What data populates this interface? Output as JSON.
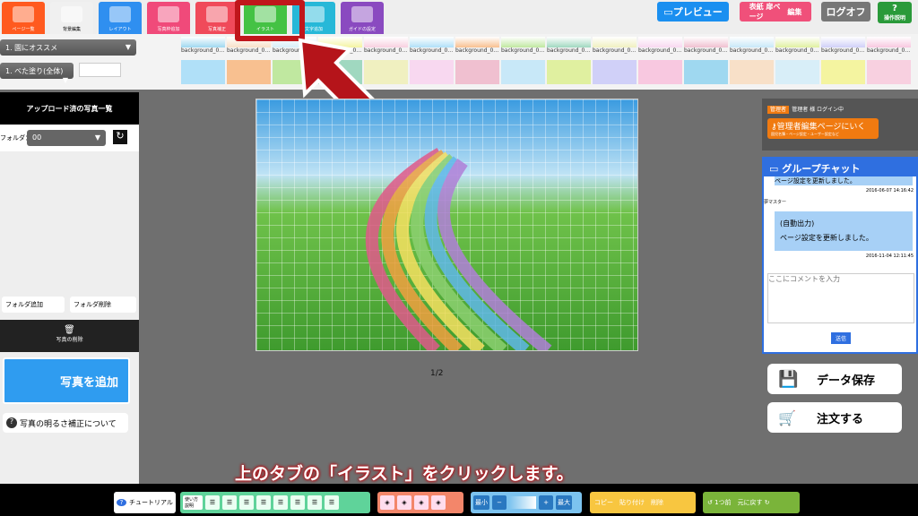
{
  "tabs": [
    {
      "label": "ページ一覧",
      "color": "#ff5a1f"
    },
    {
      "label": "背景編集",
      "color": "#f0f0f0"
    },
    {
      "label": "レイアウト",
      "color": "#2f8ff0"
    },
    {
      "label": "写真枠追加",
      "color": "#f04a7a"
    },
    {
      "label": "写真補正",
      "color": "#f04a5a"
    },
    {
      "label": "イラスト",
      "color": "#44c244"
    },
    {
      "label": "文字追加",
      "color": "#27b8d8"
    },
    {
      "label": "ガイドの設定",
      "color": "#8a4ac0"
    }
  ],
  "top_buttons": {
    "preview": "プレビュー",
    "cover": "表紙 扉ページ",
    "edit": "編集",
    "logoff": "ログオフ",
    "help": "操作説明"
  },
  "dropdowns": {
    "recommend": "1. 園にオススメ",
    "fill": "1. べた塗り(全体)"
  },
  "thumbnail_label": "background_0…",
  "left": {
    "title": "アップロード済の写真一覧",
    "folder_label": "フォルダ：",
    "folder_value": "00",
    "add_folder": "フォルダ追加",
    "delete_folder": "フォルダ削除",
    "delete_photo": "写真の削除",
    "add_photo": "写真を追加",
    "brightness": "写真の明るさ補正について"
  },
  "page_indicator": "1/2",
  "right": {
    "admin_badge": "管理者",
    "admin_login": "管理者 様 ログイン中",
    "admin_link": "管理者編集ページにいく",
    "admin_link_sub": "園児名簿・ページ設定・ユーザー設定など",
    "chat_title": "グループチャット",
    "msg1_tail": "ページ設定を更新しました。",
    "msg1_time": "2016-06-07 14:16:42",
    "sender": "夢マスター",
    "msg2_l1": "(自動出力)",
    "msg2_l2": "ページ設定を更新しました。",
    "msg2_time": "2016-11-04 12:11:45",
    "comment_placeholder": "ここにコメントを入力",
    "send": "送信",
    "save": "データ保存",
    "order": "注文する"
  },
  "caption": "上のタブの「イラスト」をクリックします。",
  "bottom": {
    "tutorial": "チュートリアル",
    "howto": "使い方説明",
    "min": "最小",
    "max": "最大",
    "copy": "コピー",
    "paste": "貼り付け",
    "delete": "削除",
    "undo": "1つ前",
    "redo": "元に戻す"
  },
  "colors": {
    "highlight": "#c0161b",
    "accent": "#2f6fe0"
  }
}
